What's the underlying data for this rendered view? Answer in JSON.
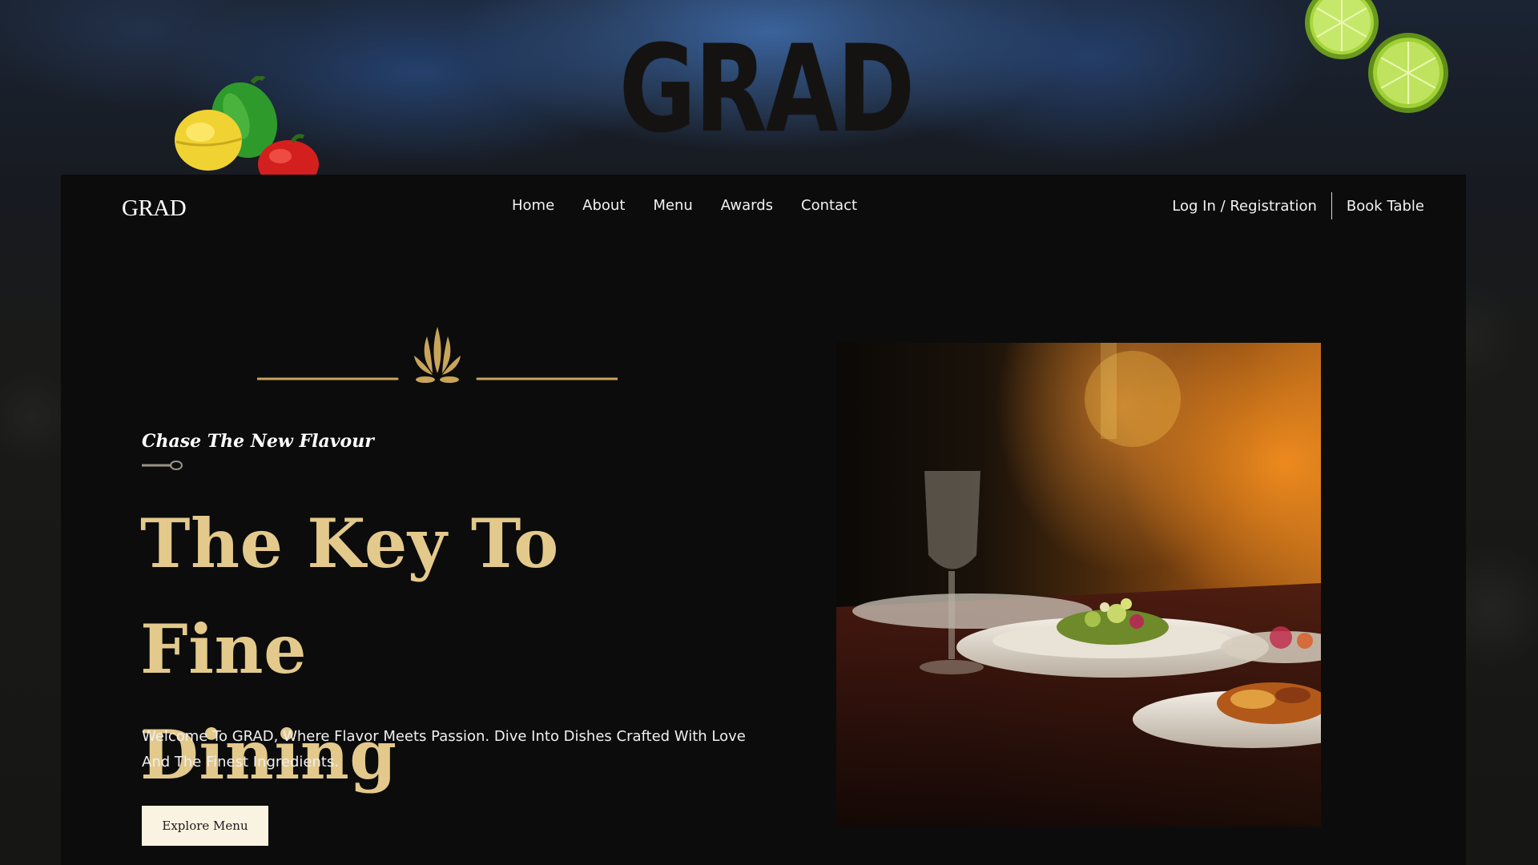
{
  "hero_logo": "GRAD",
  "nav": {
    "logo": "GRAD",
    "links": [
      "Home",
      "About",
      "Menu",
      "Awards",
      "Contact"
    ],
    "login": "Log In / Registration",
    "book_table": "Book Table"
  },
  "hero": {
    "eyebrow": "Chase The New Flavour",
    "headline_line1": "The Key To Fine",
    "headline_line2": "Dining",
    "intro": "Welcome To GRAD, Where Flavor Meets Passion. Dive Into Dishes Crafted With Love And The Finest Ingredients.",
    "cta_label": "Explore Menu"
  },
  "colors": {
    "accent_gold": "#e3c98b",
    "ornament_gold": "#c9a55a",
    "panel_bg": "#0c0c0c",
    "cta_bg": "#fbf3e1"
  },
  "icons": {
    "ornament": "wheat-sprig-ornament",
    "eyebrow_mark": "spoon-icon"
  }
}
